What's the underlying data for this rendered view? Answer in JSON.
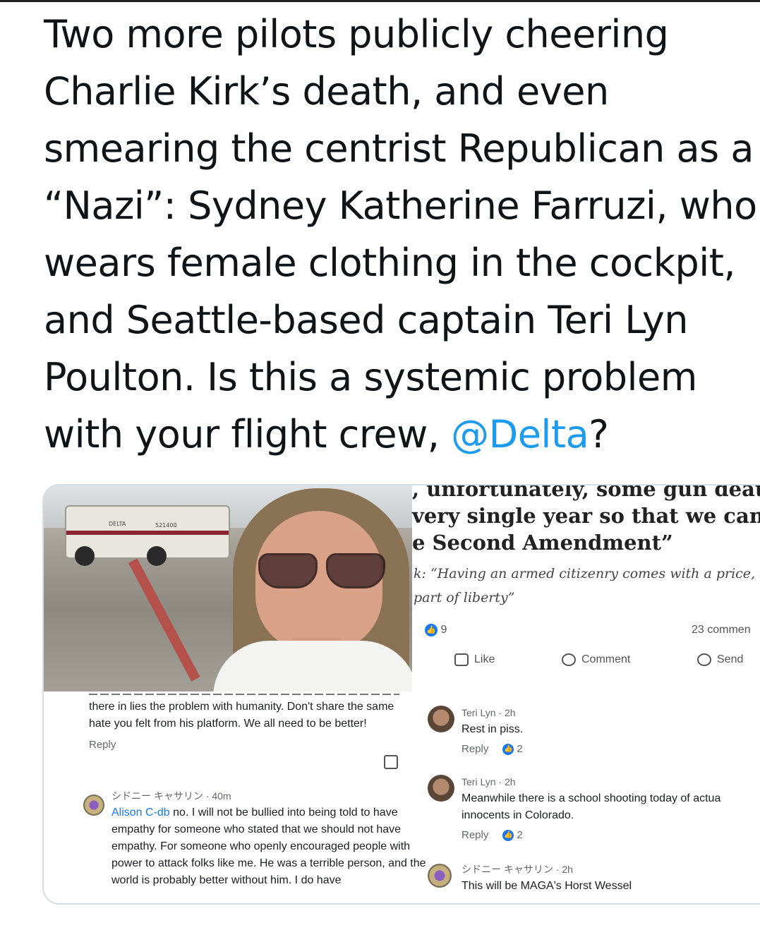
{
  "tweet": {
    "lines": [
      "Two more pilots publicly cheering",
      "Charlie Kirk’s death, and even",
      "smearing the centrist Republican as a",
      "“Nazi”: Sydney Katherine Farruzi, who",
      "wears female clothing in the cockpit,",
      "and Seattle-based captain Teri Lyn",
      "Poulton. Is this a systemic problem",
      "with your flight crew, "
    ],
    "mention": "@Delta",
    "end": "?"
  },
  "photo": {
    "truck_tag": "DELTA",
    "truck_number": "521400"
  },
  "facebook_post": {
    "article_lines": [
      ", unfortunately, some gun deaths",
      "very single year so that we can ha",
      "e Second Amendment”"
    ],
    "quote_lines": [
      "k: “Having an armed citizenry comes with a price, and",
      "part of liberty”"
    ],
    "reactions_count": "9",
    "comments_count": "23 commen",
    "actions": {
      "like": "Like",
      "comment": "Comment",
      "send": "Send"
    }
  },
  "left_comments": {
    "first": {
      "text": "there in lies the problem with humanity.  Don't share the same hate you felt from his platform. We all need to be better!",
      "reply": "Reply"
    },
    "second": {
      "author": "シドニー キャサリン",
      "time": "· 40m",
      "mention": "Alison C-db",
      "text": " no. I will not be bullied into being told to have empathy for someone who stated that we should not have empathy. For someone who openly encouraged people with power to attack folks like me. He was a terrible person, and the world is probably better without him. I do have"
    }
  },
  "right_comments": [
    {
      "author": "Teri Lyn",
      "time": "· 2h",
      "text": "Rest in piss.",
      "reply": "Reply",
      "reactions": "2"
    },
    {
      "author": "Teri Lyn",
      "time": "· 2h",
      "text": "Meanwhile there is a school shooting today of actua innocents in Colorado.",
      "reply": "Reply",
      "reactions": "2"
    },
    {
      "author": "シドニー キャサリン",
      "time": "· 2h",
      "text": "This will be MAGA's Horst Wessel"
    }
  ],
  "colors": {
    "mention": "#1d9bf0",
    "facebook_blue": "#1877f2"
  }
}
